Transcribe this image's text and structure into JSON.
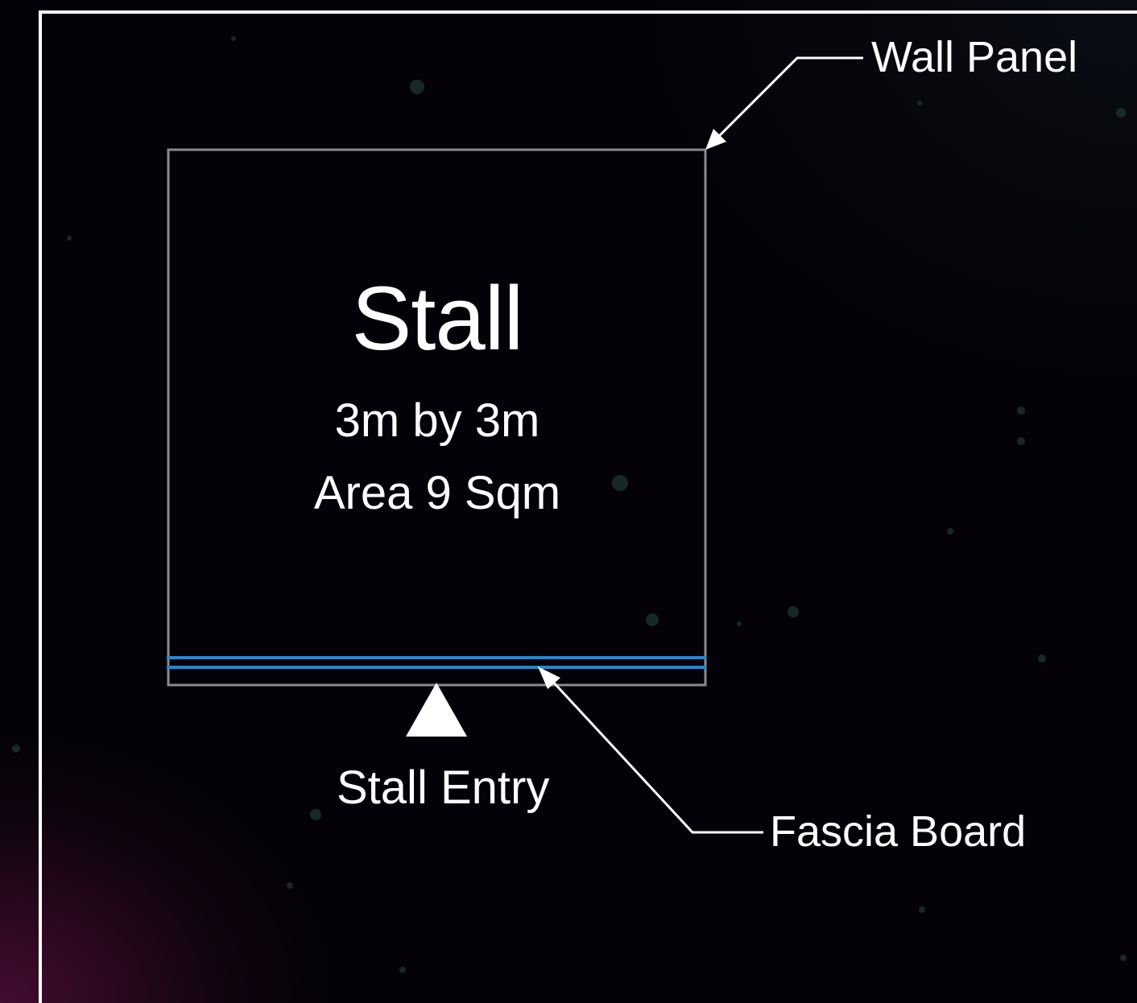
{
  "diagram": {
    "stall_title": "Stall",
    "stall_size": "3m by 3m",
    "stall_area": "Area 9 Sqm",
    "entry_label": "Stall Entry",
    "callouts": {
      "wall_panel": "Wall Panel",
      "fascia_board": "Fascia Board"
    }
  },
  "colors": {
    "frame": "#ffffff",
    "stall_outline": "#8a8a8a",
    "fascia": "#1e88d8",
    "text": "#ffffff",
    "background": "#040208"
  }
}
